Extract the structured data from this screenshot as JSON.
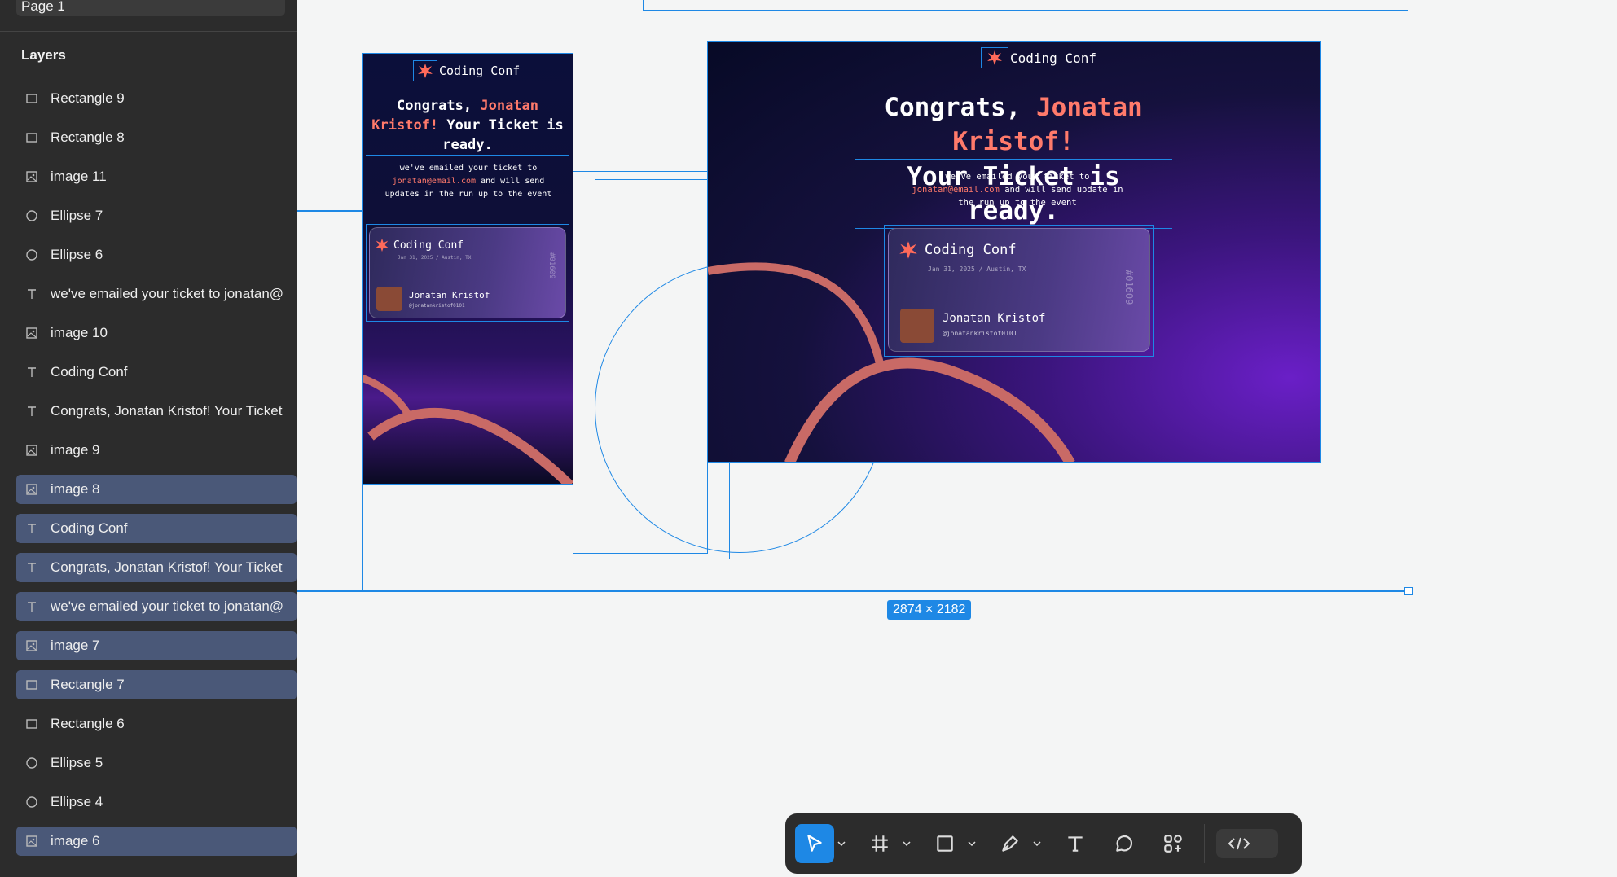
{
  "sidebar": {
    "page_label": "Page 1",
    "layers_title": "Layers",
    "layers": [
      {
        "name": "Rectangle 9",
        "icon": "rectangle-icon",
        "selected": false
      },
      {
        "name": "Rectangle 8",
        "icon": "rectangle-icon",
        "selected": false
      },
      {
        "name": "image 11",
        "icon": "image-icon",
        "selected": false
      },
      {
        "name": "Ellipse 7",
        "icon": "ellipse-icon",
        "selected": false
      },
      {
        "name": "Ellipse 6",
        "icon": "ellipse-icon",
        "selected": false
      },
      {
        "name": "we've emailed your ticket to jonatan@",
        "icon": "text-icon",
        "selected": false
      },
      {
        "name": "image 10",
        "icon": "image-icon",
        "selected": false
      },
      {
        "name": "Coding Conf",
        "icon": "text-icon",
        "selected": false
      },
      {
        "name": "Congrats, Jonatan Kristof! Your Ticket",
        "icon": "text-icon",
        "selected": false
      },
      {
        "name": "image 9",
        "icon": "image-icon",
        "selected": false
      },
      {
        "name": "image 8",
        "icon": "image-icon",
        "selected": true
      },
      {
        "name": "Coding Conf",
        "icon": "text-icon",
        "selected": true
      },
      {
        "name": "Congrats, Jonatan Kristof! Your Ticket",
        "icon": "text-icon",
        "selected": true
      },
      {
        "name": "we've emailed your ticket to jonatan@",
        "icon": "text-icon",
        "selected": true
      },
      {
        "name": "image 7",
        "icon": "image-icon",
        "selected": true
      },
      {
        "name": "Rectangle 7",
        "icon": "rectangle-icon",
        "selected": true
      },
      {
        "name": "Rectangle 6",
        "icon": "rectangle-icon",
        "selected": false
      },
      {
        "name": "Ellipse 5",
        "icon": "ellipse-icon",
        "selected": false
      },
      {
        "name": "Ellipse 4",
        "icon": "ellipse-icon",
        "selected": false
      },
      {
        "name": "image 6",
        "icon": "image-icon",
        "selected": true
      }
    ]
  },
  "canvas": {
    "selection_size": "2874 × 2182",
    "accent_color": "#1e88e5"
  },
  "mobile_design": {
    "brand": "Coding Conf",
    "congrats": "Congrats,",
    "name_line1": "Jonatan",
    "name_line2": "Kristof!",
    "ticket_ready": "Your Ticket is",
    "ready": "ready.",
    "sub_line1": "we've emailed your ticket to",
    "sub_email": "jonatan@email.com",
    "sub_line2_rest": "and will send",
    "sub_line3": "updates in the run up to the event",
    "ticket_brand": "Coding Conf",
    "ticket_date": "Jan 31, 2025 / Austin, TX",
    "ticket_name": "Jonatan Kristof",
    "ticket_handle": "@jonatankristof0101",
    "ticket_number": "#01609"
  },
  "desktop_design": {
    "brand": "Coding Conf",
    "congrats": "Congrats,",
    "name": "Jonatan Kristof!",
    "ticket_ready": "Your Ticket is ready.",
    "sub_line1": "we've emailed your ticket to",
    "sub_email": "jonatan@email.com",
    "sub_line2_rest": "and will send update in",
    "sub_line3": "the run up to the event",
    "ticket_brand": "Coding Conf",
    "ticket_date": "Jan 31, 2025 / Austin, TX",
    "ticket_name": "Jonatan Kristof",
    "ticket_handle": "@jonatankristof0101",
    "ticket_number": "#01609"
  },
  "toolbar": {
    "tools": [
      "move-tool",
      "frame-tool",
      "shape-tool",
      "pen-tool",
      "text-tool",
      "comment-tool",
      "components-tool",
      "dev-mode-toggle"
    ]
  }
}
